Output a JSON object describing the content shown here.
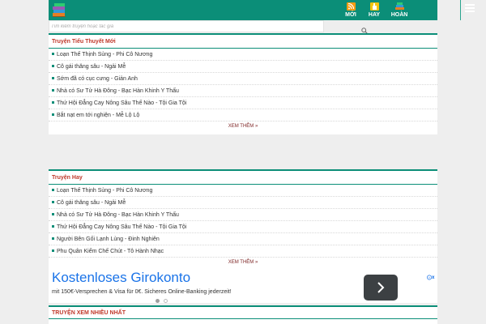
{
  "header": {
    "nav": [
      {
        "label": "MỚI"
      },
      {
        "label": "HAY"
      },
      {
        "label": "HOÀN"
      }
    ]
  },
  "search": {
    "placeholder": "Tìm kiếm truyện hoặc tác giả"
  },
  "section_new": {
    "title": "Truyện Tiểu Thuyết Mới",
    "items": [
      "Loạn Thế Thịnh Sủng - Phi Cô Nương",
      "Cô gái thăng sâu - Ngải Mễ",
      "Sớm đã có cục cưng - Giản Anh",
      "Nhà có Sư Tử Hà Đông - Bạc Hàn Khinh Y Thấu",
      "Thứ Hội Đẳng Cay Nông Sâu Thế Nào - Tội Gia Tội",
      "Bắt nạt em tới nghiện - Mễ Lộ Lộ"
    ],
    "more": "XEM THÊM »"
  },
  "section_hot": {
    "title": "Truyện Hay",
    "items": [
      "Loạn Thế Thịnh Sủng - Phi Cô Nương",
      "Cô gái thăng sâu - Ngải Mễ",
      "Nhà có Sư Tử Hà Đông - Bạc Hàn Khinh Y Thấu",
      "Thứ Hội Đẳng Cay Nông Sâu Thế Nào - Tội Gia Tội",
      "Người Bên Gối Lạnh Lùng - Đinh Nghiên",
      "Phu Quân Kiểm Chế Chút - Tô Hành Nhạc"
    ],
    "more": "XEM THÊM »"
  },
  "ad": {
    "title": "Kostenloses Girokonto",
    "text": "mit 150€-Versprechen & Visa für 0€. Sicheres Online-Banking jederzeit!"
  },
  "section_most_viewed": {
    "title": "TRUYỆN XEM NHIỀU NHẤT"
  },
  "colors": {
    "brand": "#0b8e78",
    "section_title": "#c0392b"
  }
}
